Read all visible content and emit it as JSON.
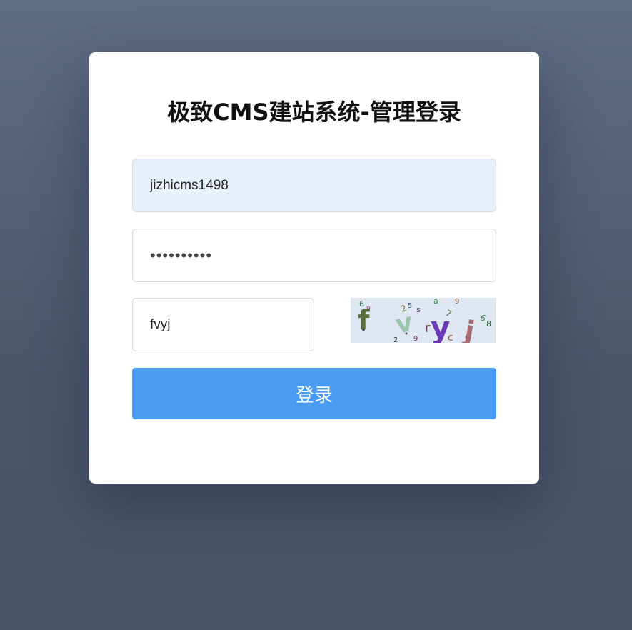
{
  "login": {
    "title": "极致CMS建站系统-管理登录",
    "username_value": "jizhicms1498",
    "password_value": "••••••••••",
    "captcha_value": "fvyj",
    "captcha_image": {
      "icon": "captcha-image",
      "background": "#dfe7f3"
    },
    "submit_label": "登录"
  },
  "colors": {
    "page_background": "#566078",
    "card_background": "#ffffff",
    "autofill_background": "#e8f0fe",
    "button_background": "#4a9bf3",
    "button_text": "#ffffff"
  }
}
